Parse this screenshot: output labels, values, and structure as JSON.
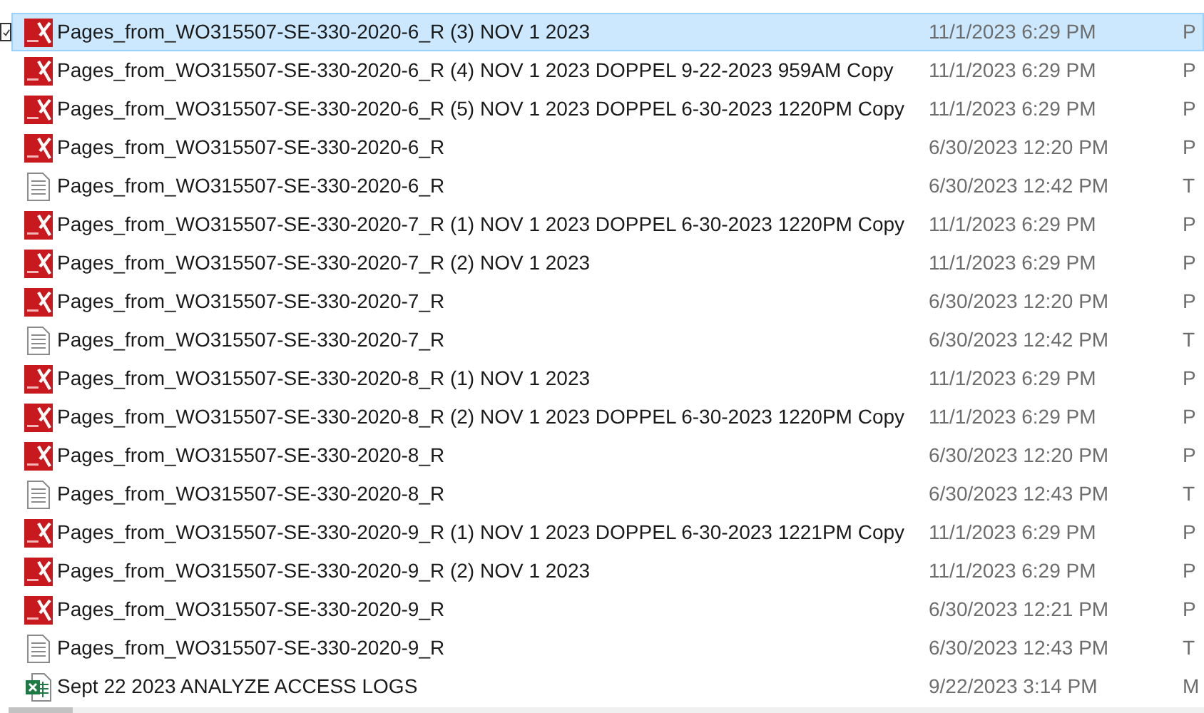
{
  "files": [
    {
      "name": "Pages_from_WO315507-SE-330-2020-6_R (3) NOV 1 2023",
      "date": "11/1/2023 6:29 PM",
      "column_3": "P",
      "kind": "pdf",
      "selected": true
    },
    {
      "name": "Pages_from_WO315507-SE-330-2020-6_R (4) NOV 1 2023 DOPPEL 9-22-2023 959AM Copy",
      "date": "11/1/2023 6:29 PM",
      "column_3": "P",
      "kind": "pdf",
      "selected": false
    },
    {
      "name": "Pages_from_WO315507-SE-330-2020-6_R (5) NOV 1 2023 DOPPEL 6-30-2023 1220PM Copy",
      "date": "11/1/2023 6:29 PM",
      "column_3": "P",
      "kind": "pdf",
      "selected": false
    },
    {
      "name": "Pages_from_WO315507-SE-330-2020-6_R",
      "date": "6/30/2023 12:20 PM",
      "column_3": "P",
      "kind": "pdf",
      "selected": false
    },
    {
      "name": "Pages_from_WO315507-SE-330-2020-6_R",
      "date": "6/30/2023 12:42 PM",
      "column_3": "T",
      "kind": "text",
      "selected": false
    },
    {
      "name": "Pages_from_WO315507-SE-330-2020-7_R (1) NOV 1 2023 DOPPEL 6-30-2023 1220PM Copy",
      "date": "11/1/2023 6:29 PM",
      "column_3": "P",
      "kind": "pdf",
      "selected": false
    },
    {
      "name": "Pages_from_WO315507-SE-330-2020-7_R (2) NOV 1 2023",
      "date": "11/1/2023 6:29 PM",
      "column_3": "P",
      "kind": "pdf",
      "selected": false
    },
    {
      "name": "Pages_from_WO315507-SE-330-2020-7_R",
      "date": "6/30/2023 12:20 PM",
      "column_3": "P",
      "kind": "pdf",
      "selected": false
    },
    {
      "name": "Pages_from_WO315507-SE-330-2020-7_R",
      "date": "6/30/2023 12:42 PM",
      "column_3": "T",
      "kind": "text",
      "selected": false
    },
    {
      "name": "Pages_from_WO315507-SE-330-2020-8_R (1) NOV 1 2023",
      "date": "11/1/2023 6:29 PM",
      "column_3": "P",
      "kind": "pdf",
      "selected": false
    },
    {
      "name": "Pages_from_WO315507-SE-330-2020-8_R (2) NOV 1 2023 DOPPEL 6-30-2023 1220PM Copy",
      "date": "11/1/2023 6:29 PM",
      "column_3": "P",
      "kind": "pdf",
      "selected": false
    },
    {
      "name": "Pages_from_WO315507-SE-330-2020-8_R",
      "date": "6/30/2023 12:20 PM",
      "column_3": "P",
      "kind": "pdf",
      "selected": false
    },
    {
      "name": "Pages_from_WO315507-SE-330-2020-8_R",
      "date": "6/30/2023 12:43 PM",
      "column_3": "T",
      "kind": "text",
      "selected": false
    },
    {
      "name": "Pages_from_WO315507-SE-330-2020-9_R (1) NOV 1 2023 DOPPEL 6-30-2023 1221PM Copy",
      "date": "11/1/2023 6:29 PM",
      "column_3": "P",
      "kind": "pdf",
      "selected": false
    },
    {
      "name": "Pages_from_WO315507-SE-330-2020-9_R (2) NOV 1 2023",
      "date": "11/1/2023 6:29 PM",
      "column_3": "P",
      "kind": "pdf",
      "selected": false
    },
    {
      "name": "Pages_from_WO315507-SE-330-2020-9_R",
      "date": "6/30/2023 12:21 PM",
      "column_3": "P",
      "kind": "pdf",
      "selected": false
    },
    {
      "name": "Pages_from_WO315507-SE-330-2020-9_R",
      "date": "6/30/2023 12:43 PM",
      "column_3": "T",
      "kind": "text",
      "selected": false
    },
    {
      "name": "Sept 22 2023 ANALYZE ACCESS LOGS",
      "date": "9/22/2023 3:14 PM",
      "column_3": "M",
      "kind": "excel",
      "selected": false
    }
  ]
}
